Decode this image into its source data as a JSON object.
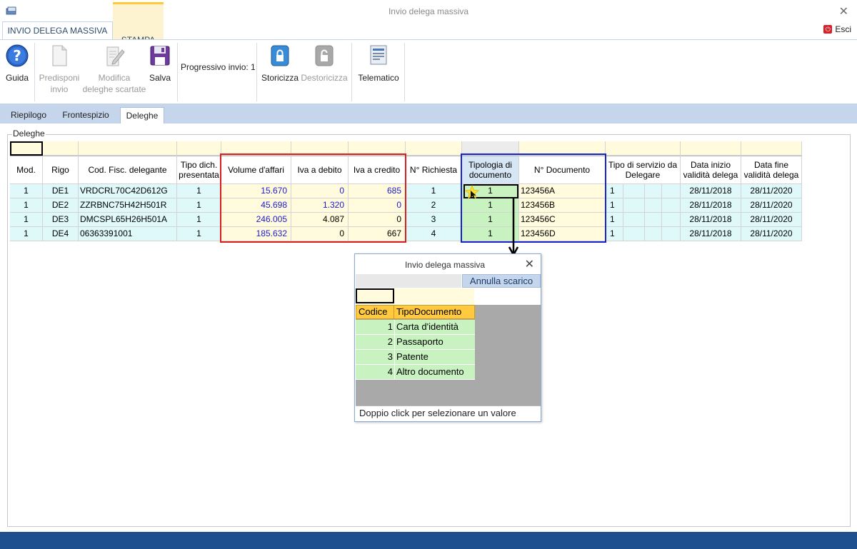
{
  "window": {
    "title": "Invio delega massiva",
    "close_glyph": "✕"
  },
  "ribbon_tabs": [
    {
      "label": "INVIO DELEGA MASSIVA"
    },
    {
      "label": "STAMPA"
    }
  ],
  "esci": {
    "label": "Esci"
  },
  "ribbon": {
    "guida": "Guida",
    "predisponi_1": "Predisponi",
    "predisponi_2": "invio",
    "modifica_1": "Modifica",
    "modifica_2": "deleghe scartate",
    "salva": "Salva",
    "progressivo": "Progressivo invio: 1",
    "storicizza": "Storicizza",
    "destoricizza": "Destoricizza",
    "telematico": "Telematico"
  },
  "sub_tabs": [
    {
      "label": "Riepilogo"
    },
    {
      "label": "Frontespizio"
    },
    {
      "label": "Deleghe"
    }
  ],
  "group": {
    "label": "Deleghe"
  },
  "grid": {
    "headers": [
      "Mod.",
      "Rigo",
      "Cod. Fisc. delegante",
      "Tipo dich. presentata",
      "Volume d'affari",
      "Iva a debito",
      "Iva a credito",
      "N° Richiesta",
      "Tipologia di documento",
      "N° Documento",
      "Tipo di servizio da Delegare",
      "Data inizio validità delega",
      "Data fine validità delega"
    ],
    "rows": [
      {
        "mod": "1",
        "rigo": "DE1",
        "cf": "VRDCRL70C42D612G",
        "tipo": "1",
        "volume": "15.670",
        "debito": "0",
        "credito": "685",
        "richiesta": "1",
        "tipologia": "1",
        "documento": "123456A",
        "servizio": "1",
        "inizio": "28/11/2018",
        "fine": "28/11/2020"
      },
      {
        "mod": "1",
        "rigo": "DE2",
        "cf": "ZZRBNC75H42H501R",
        "tipo": "1",
        "volume": "45.698",
        "debito": "1.320",
        "credito": "0",
        "richiesta": "2",
        "tipologia": "1",
        "documento": "123456B",
        "servizio": "1",
        "inizio": "28/11/2018",
        "fine": "28/11/2020"
      },
      {
        "mod": "1",
        "rigo": "DE3",
        "cf": "DMCSPL65H26H501A",
        "tipo": "1",
        "volume": "246.005",
        "debito": "4.087",
        "credito": "0",
        "richiesta": "3",
        "tipologia": "1",
        "documento": "123456C",
        "servizio": "1",
        "inizio": "28/11/2018",
        "fine": "28/11/2020"
      },
      {
        "mod": "1",
        "rigo": "DE4",
        "cf": "06363391001",
        "tipo": "1",
        "volume": "185.632",
        "debito": "0",
        "credito": "667",
        "richiesta": "4",
        "tipologia": "1",
        "documento": "123456D",
        "servizio": "1",
        "inizio": "28/11/2018",
        "fine": "28/11/2020"
      }
    ]
  },
  "popup": {
    "title": "Invio delega massiva",
    "close_glyph": "✕",
    "annulla": "Annulla scarico",
    "headers": {
      "codice": "Codice",
      "tipo": "TipoDocumento"
    },
    "rows": [
      {
        "codice": "1",
        "tipo": "Carta d'identità"
      },
      {
        "codice": "2",
        "tipo": "Passaporto"
      },
      {
        "codice": "3",
        "tipo": "Patente"
      },
      {
        "codice": "4",
        "tipo": "Altro documento"
      }
    ],
    "status": "Doppio click per selezionare un valore"
  },
  "colors": {
    "row_cyan": "#dff9fb",
    "row_yellow": "#fffbdc",
    "cell_green": "#c8f2c0",
    "highlight_red": "#d81e1e",
    "highlight_blue": "#1722c8",
    "status_bar": "#1e4f8f"
  }
}
